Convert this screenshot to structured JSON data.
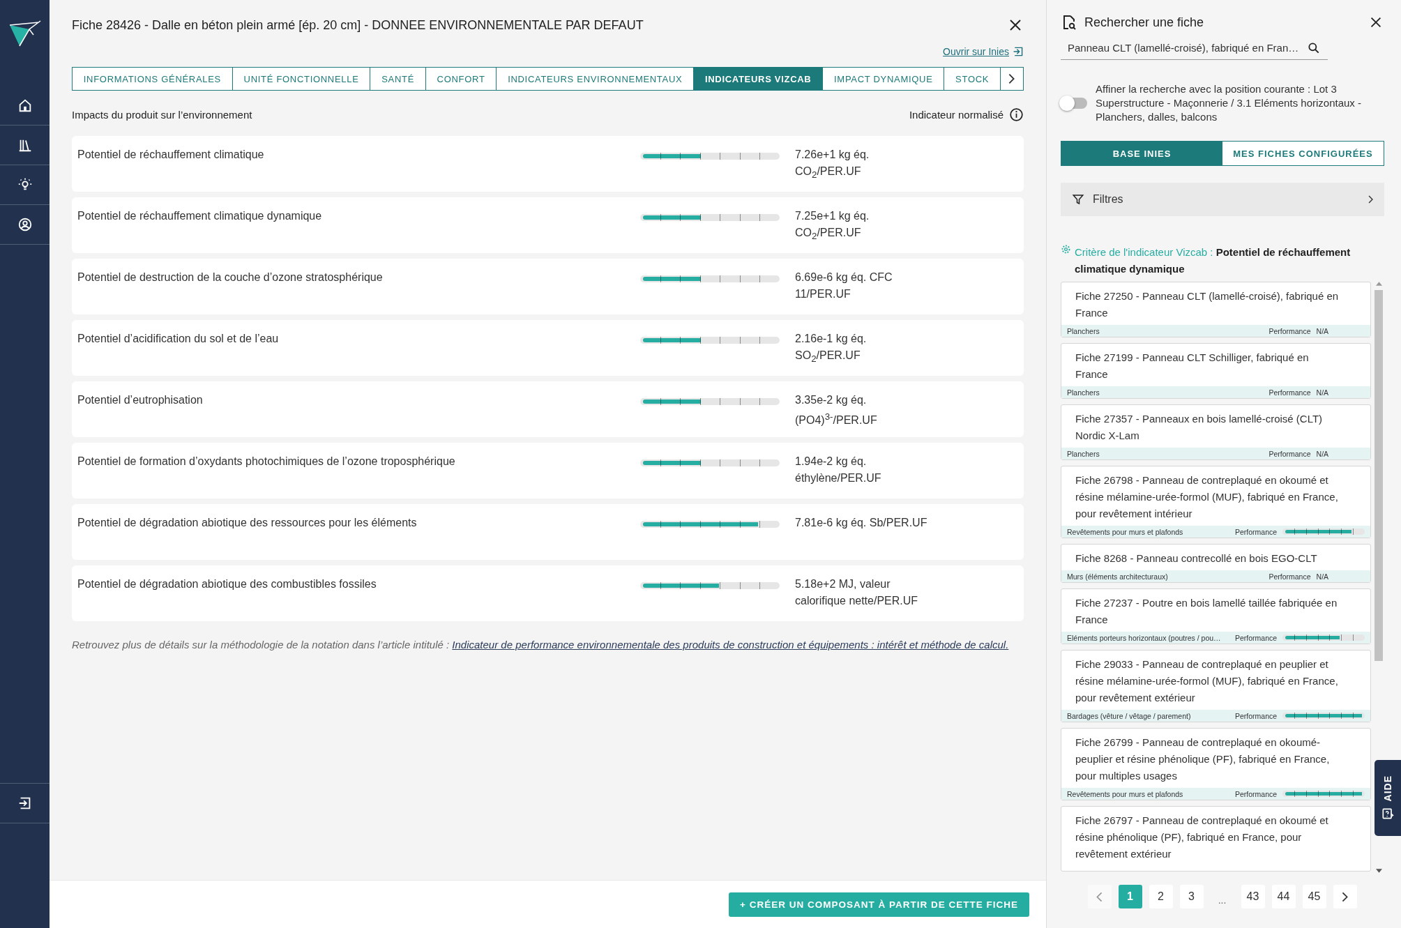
{
  "fiche": {
    "title": "Fiche 28426 - Dalle en béton plein armé [ép. 20 cm] - DONNEE ENVIRONNEMENTALE PAR DEFAUT",
    "open_link": "Ouvrir sur Inies",
    "tabs": [
      {
        "label": "INFORMATIONS GÉNÉRALES",
        "selected": false
      },
      {
        "label": "UNITÉ FONCTIONNELLE",
        "selected": false
      },
      {
        "label": "SANTÉ",
        "selected": false
      },
      {
        "label": "CONFORT",
        "selected": false
      },
      {
        "label": "INDICATEURS ENVIRONNEMENTAUX",
        "selected": false
      },
      {
        "label": "INDICATEURS VIZCAB",
        "selected": true
      },
      {
        "label": "IMPACT DYNAMIQUE",
        "selected": false
      },
      {
        "label": "STOCK",
        "selected": false
      }
    ],
    "section_title": "Impacts du produit sur l’environnement",
    "normalized_label": "Indicateur normalisé",
    "impacts": [
      {
        "label": "Potentiel de réchauffement climatique",
        "level": 0.43,
        "value": "7.26e+1 kg éq. CO$_{2}$/PER.UF"
      },
      {
        "label": "Potentiel de réchauffement climatique dynamique",
        "level": 0.43,
        "value": "7.25e+1 kg éq. CO$_{2}$/PER.UF"
      },
      {
        "label": "Potentiel de destruction de la couche d’ozone stratosphérique",
        "level": 0.43,
        "value": "6.69e-6 kg éq. CFC 11/PER.UF"
      },
      {
        "label": "Potentiel d’acidification du sol et de l’eau",
        "level": 0.43,
        "value": "2.16e-1 kg éq. SO$_{2}$/PER.UF"
      },
      {
        "label": "Potentiel d’eutrophisation",
        "level": 0.43,
        "value": "3.35e-2 kg éq. (PO4)$^{3-}$/PER.UF"
      },
      {
        "label": "Potentiel de formation d’oxydants photochimiques de l’ozone troposphérique",
        "level": 0.43,
        "value": "1.94e-2 kg éq. éthylène/PER.UF"
      },
      {
        "label": "Potentiel de dégradation abiotique des ressources pour les éléments",
        "level": 0.86,
        "value": "7.81e-6 kg éq. Sb/PER.UF"
      },
      {
        "label": "Potentiel de dégradation abiotique des combustibles fossiles",
        "level": 0.57,
        "value": "5.18e+2 MJ, valeur calorifique nette/PER.UF"
      }
    ],
    "note": {
      "text": "Retrouvez plus de détails sur la méthodologie de la notation dans l’article intitulé :",
      "link": "Indicateur de performance environnementale des produits de construction et équipements : intérêt et méthode de calcul."
    },
    "create_button": "+ CRÉER UN COMPOSANT À PARTIR DE CETTE FICHE"
  },
  "search_panel": {
    "title": "Rechercher une fiche",
    "search": {
      "value": "Panneau CLT (lamellé-croisé), fabriqué en Fran…"
    },
    "refine": {
      "on": false,
      "label": "Affiner la recherche avec la position courante : Lot 3 Superstructure - Maçonnerie / 3.1 Eléments horizontaux - Planchers, dalles, balcons"
    },
    "sources": [
      {
        "label": "BASE INIES",
        "selected": true
      },
      {
        "label": "MES FICHES CONFIGURÉES",
        "selected": false
      }
    ],
    "filters": "Filtres",
    "criterion": {
      "label": "Critère de l'indicateur Vizcab :",
      "value": "Potentiel de réchauffement climatique dynamique"
    },
    "results": [
      {
        "kind": "na",
        "title": "Fiche 27250 - Panneau CLT (lamellé-croisé), fabriqué en France",
        "category": "Planchers",
        "performance_label": "Performance",
        "performance": "N/A"
      },
      {
        "kind": "na",
        "title": "Fiche 27199 - Panneau CLT Schilliger, fabriqué en France",
        "category": "Planchers",
        "performance_label": "Performance",
        "performance": "N/A"
      },
      {
        "kind": "na",
        "title": "Fiche 27357 - Panneaux en bois lamellé-croisé (CLT) Nordic X-Lam",
        "category": "Planchers",
        "performance_label": "Performance",
        "performance": "N/A"
      },
      {
        "kind": "score",
        "title": "Fiche 26798 - Panneau de contreplaqué en okoumé et résine mélamine-urée-formol (MUF), fabriqué en France, pour revêtement intérieur",
        "category": "Revêtements pour murs et plafonds",
        "performance_label": "Performance",
        "level": 0.86
      },
      {
        "kind": "na",
        "title": "Fiche 8268 - Panneau contrecollé en bois EGO-CLT",
        "category": "Murs (éléments architecturaux)",
        "performance_label": "Performance",
        "performance": "N/A"
      },
      {
        "kind": "score",
        "title": "Fiche 27237 - Poutre en bois lamellé taillée fabriquée en France",
        "category": "Eléments porteurs horizontaux (poutres / pou…",
        "performance_label": "Performance",
        "level": 0.71
      },
      {
        "kind": "score",
        "title": "Fiche 29033 - Panneau de contreplaqué en peuplier et résine mélamine-urée-formol (MUF), fabriqué en France, pour revêtement extérieur",
        "category": "Bardages (vêture / vêtage / parement)",
        "performance_label": "Performance",
        "level": 1
      },
      {
        "kind": "score",
        "title": "Fiche 26799 - Panneau de contreplaqué en okoumé-peuplier et résine phénolique (PF), fabriqué en France, pour multiples usages",
        "category": "Revêtements pour murs et plafonds",
        "performance_label": "Performance",
        "level": 1
      },
      {
        "kind": "title_only",
        "title": "Fiche 26797 - Panneau de contreplaqué en okoumé et résine phénolique (PF), fabriqué en France, pour revêtement extérieur"
      }
    ],
    "pages": [
      {
        "kind": "page",
        "label": "1",
        "selected": true
      },
      {
        "kind": "page",
        "label": "2",
        "selected": false
      },
      {
        "kind": "page",
        "label": "3",
        "selected": false
      },
      {
        "kind": "gap",
        "label": "..."
      },
      {
        "kind": "page",
        "label": "43",
        "selected": false
      },
      {
        "kind": "page",
        "label": "44",
        "selected": false
      },
      {
        "kind": "page",
        "label": "45",
        "selected": false
      }
    ],
    "help_tab": "AIDE"
  }
}
